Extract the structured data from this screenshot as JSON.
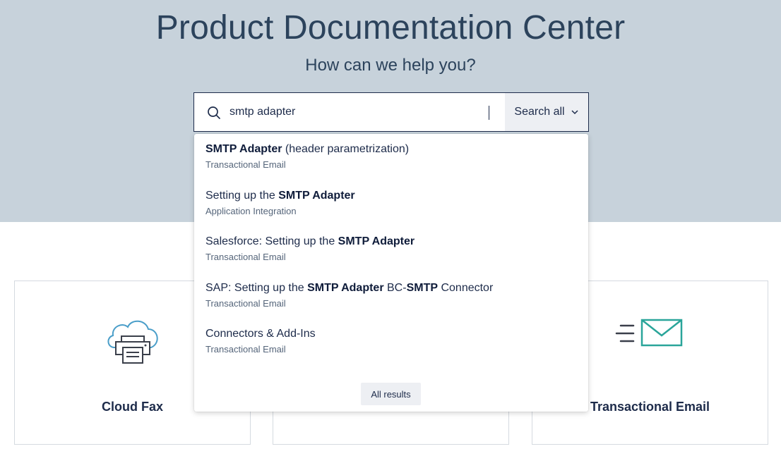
{
  "hero": {
    "title": "Product Documentation Center",
    "subtitle": "How can we help you?"
  },
  "search": {
    "value": "smtp adapter",
    "scope_label": "Search all",
    "icon": "search-icon"
  },
  "suggestions": [
    {
      "parts": [
        {
          "t": "SMTP Adapter",
          "b": true
        },
        {
          "t": " (header parametrization)",
          "b": false
        }
      ],
      "category": "Transactional Email"
    },
    {
      "parts": [
        {
          "t": "Setting up the ",
          "b": false
        },
        {
          "t": "SMTP Adapter",
          "b": true
        }
      ],
      "category": "Application Integration"
    },
    {
      "parts": [
        {
          "t": "Salesforce: Setting up the ",
          "b": false
        },
        {
          "t": "SMTP Adapter",
          "b": true
        }
      ],
      "category": "Transactional Email"
    },
    {
      "parts": [
        {
          "t": "SAP: Setting up the ",
          "b": false
        },
        {
          "t": "SMTP Adapter",
          "b": true
        },
        {
          "t": " BC-",
          "b": false
        },
        {
          "t": "SMTP",
          "b": true
        },
        {
          "t": " Connector",
          "b": false
        }
      ],
      "category": "Transactional Email"
    },
    {
      "parts": [
        {
          "t": "Connectors & Add-Ins",
          "b": false
        }
      ],
      "category": "Transactional Email"
    }
  ],
  "all_results_label": "All results",
  "cards": [
    {
      "label": "Cloud Fax",
      "icon": "cloud-printer-icon"
    },
    {
      "label": "",
      "icon": ""
    },
    {
      "label": "Transactional Email",
      "icon": "envelope-icon"
    }
  ],
  "colors": {
    "hero_bg": "#c7d2db",
    "heading": "#2c435c",
    "text": "#1d2b4a",
    "cloud_blue": "#4a9ec9",
    "mail_green": "#2aa59a"
  }
}
